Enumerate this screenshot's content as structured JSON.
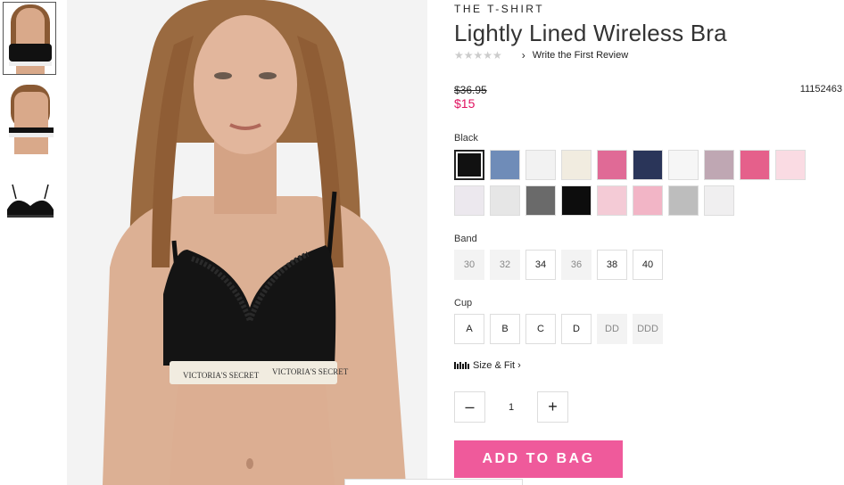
{
  "product": {
    "collection": "THE T-SHIRT",
    "title": "Lightly Lined Wireless Bra",
    "stars": "★★★★★",
    "review_link": "Write the First Review",
    "original_price": "$36.95",
    "sale_price": "$15",
    "sku": "11152463"
  },
  "color": {
    "label": "Black",
    "swatches": [
      {
        "name": "black",
        "bg": "#111111",
        "selected": true
      },
      {
        "name": "denim",
        "bg": "#6f8cb8"
      },
      {
        "name": "white",
        "bg": "#f2f2f2"
      },
      {
        "name": "coconut",
        "bg": "#f1ece0"
      },
      {
        "name": "floral",
        "bg": "#e06a96"
      },
      {
        "name": "navy-logo",
        "bg": "#2a3559"
      },
      {
        "name": "white-logo",
        "bg": "#f6f6f6"
      },
      {
        "name": "leopard",
        "bg": "#bfa7b3"
      },
      {
        "name": "pink",
        "bg": "#e5608b"
      },
      {
        "name": "light-pink",
        "bg": "#fadbe3"
      },
      {
        "name": "script-white",
        "bg": "#ece8ee"
      },
      {
        "name": "stripe-logo",
        "bg": "#e6e6e6"
      },
      {
        "name": "charcoal",
        "bg": "#6a6a6a"
      },
      {
        "name": "black-2",
        "bg": "#0d0d0d"
      },
      {
        "name": "pink-logo",
        "bg": "#f4cbd6"
      },
      {
        "name": "pink-print",
        "bg": "#f2b5c6"
      },
      {
        "name": "grey-heather",
        "bg": "#bdbdbd"
      },
      {
        "name": "script-print",
        "bg": "#f0eff0"
      }
    ]
  },
  "band": {
    "label": "Band",
    "options": [
      {
        "value": "30",
        "available": false
      },
      {
        "value": "32",
        "available": false
      },
      {
        "value": "34",
        "available": true
      },
      {
        "value": "36",
        "available": false
      },
      {
        "value": "38",
        "available": true
      },
      {
        "value": "40",
        "available": true
      }
    ]
  },
  "cup": {
    "label": "Cup",
    "options": [
      {
        "value": "A",
        "available": true
      },
      {
        "value": "B",
        "available": true
      },
      {
        "value": "C",
        "available": true
      },
      {
        "value": "D",
        "available": true
      },
      {
        "value": "DD",
        "available": false
      },
      {
        "value": "DDD",
        "available": false
      }
    ]
  },
  "size_fit": "Size & Fit",
  "quantity": {
    "minus": "–",
    "value": "1",
    "plus": "+"
  },
  "cta": {
    "add_to_bag": "ADD TO BAG"
  },
  "colors": {
    "accent": "#ef5a9b",
    "sale": "#e0115f"
  },
  "icons": {
    "chevron": "chevron-right-icon",
    "ruler": "ruler-icon"
  }
}
